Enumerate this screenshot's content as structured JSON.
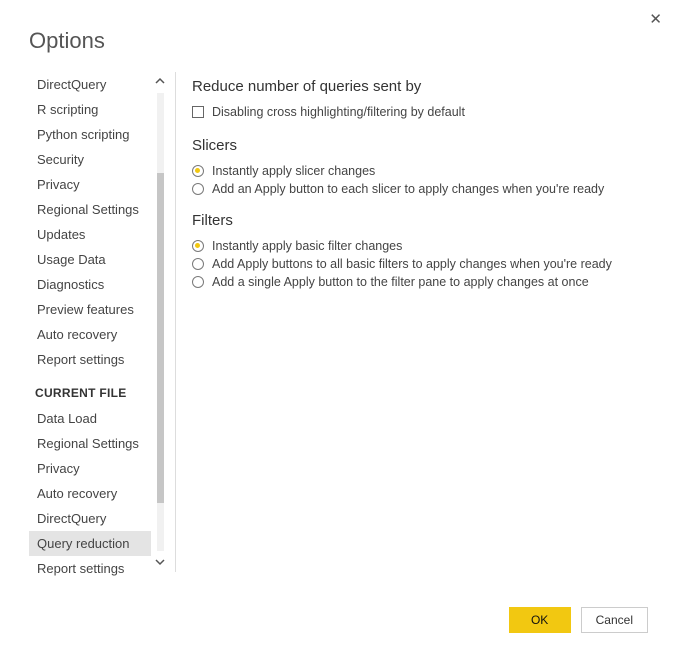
{
  "title": "Options",
  "sidebar": {
    "items_top": [
      "DirectQuery",
      "R scripting",
      "Python scripting",
      "Security",
      "Privacy",
      "Regional Settings",
      "Updates",
      "Usage Data",
      "Diagnostics",
      "Preview features",
      "Auto recovery",
      "Report settings"
    ],
    "section_header": "CURRENT FILE",
    "items_bottom": [
      "Data Load",
      "Regional Settings",
      "Privacy",
      "Auto recovery",
      "DirectQuery",
      "Query reduction",
      "Report settings"
    ],
    "selected": "Query reduction"
  },
  "content": {
    "group1_title": "Reduce number of queries sent by",
    "disable_cross": "Disabling cross highlighting/filtering by default",
    "group2_title": "Slicers",
    "slicer_instant": "Instantly apply slicer changes",
    "slicer_apply": "Add an Apply button to each slicer to apply changes when you're ready",
    "group3_title": "Filters",
    "filter_instant": "Instantly apply basic filter changes",
    "filter_apply_each": "Add Apply buttons to all basic filters to apply changes when you're ready",
    "filter_apply_single": "Add a single Apply button to the filter pane to apply changes at once"
  },
  "footer": {
    "ok": "OK",
    "cancel": "Cancel"
  }
}
